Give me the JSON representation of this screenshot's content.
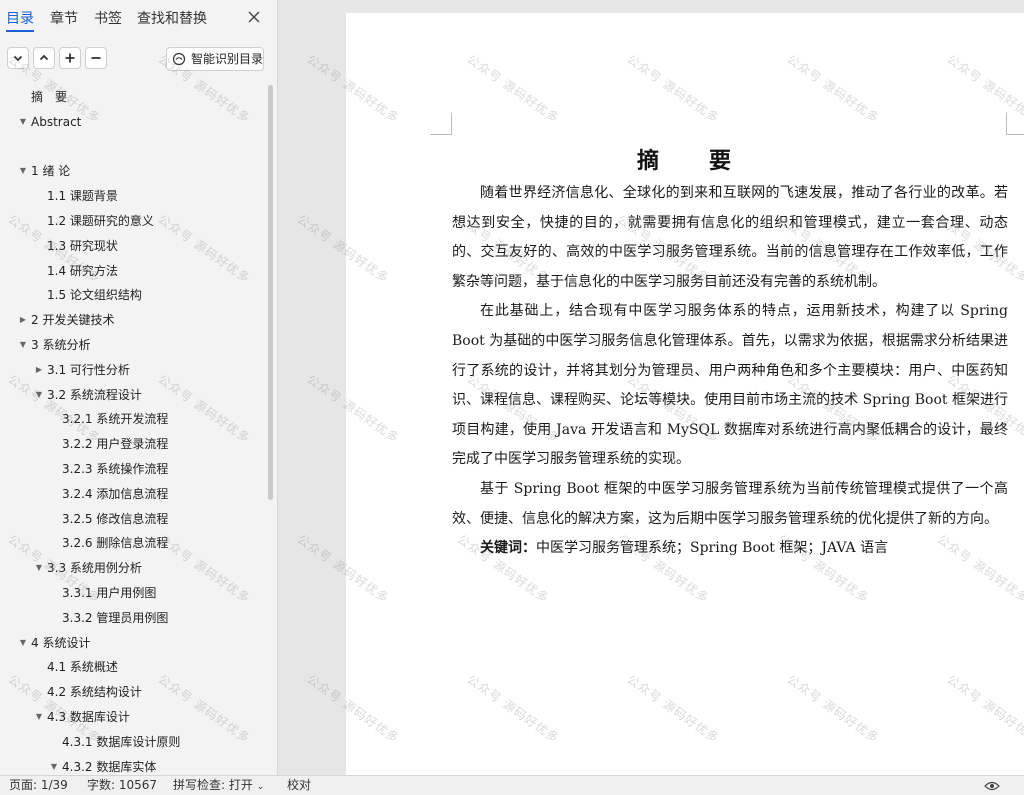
{
  "nav": {
    "tabs": [
      {
        "label": "目录",
        "active": true
      },
      {
        "label": "章节"
      },
      {
        "label": "书签"
      },
      {
        "label": "查找和替换"
      }
    ],
    "smart_toc_label": "智能识别目录",
    "toc": [
      {
        "label": "摘　要",
        "level": 0,
        "caret": ""
      },
      {
        "label": "Abstract",
        "level": 0,
        "caret": "expanded"
      },
      {
        "label": "",
        "level": 1,
        "caret": ""
      },
      {
        "label": "1 绪 论",
        "level": 0,
        "caret": "expanded"
      },
      {
        "label": "1.1 课题背景",
        "level": 1,
        "caret": ""
      },
      {
        "label": "1.2 课题研究的意义",
        "level": 1,
        "caret": ""
      },
      {
        "label": "1.3 研究现状",
        "level": 1,
        "caret": ""
      },
      {
        "label": "1.4 研究方法",
        "level": 1,
        "caret": ""
      },
      {
        "label": "1.5 论文组织结构",
        "level": 1,
        "caret": ""
      },
      {
        "label": "2 开发关键技术",
        "level": 0,
        "caret": "collapsed"
      },
      {
        "label": "3 系统分析",
        "level": 0,
        "caret": "expanded"
      },
      {
        "label": "3.1 可行性分析",
        "level": 1,
        "caret": "collapsed"
      },
      {
        "label": "3.2 系统流程设计",
        "level": 1,
        "caret": "expanded"
      },
      {
        "label": "3.2.1 系统开发流程",
        "level": 2,
        "caret": ""
      },
      {
        "label": "3.2.2 用户登录流程",
        "level": 2,
        "caret": ""
      },
      {
        "label": "3.2.3 系统操作流程",
        "level": 2,
        "caret": ""
      },
      {
        "label": "3.2.4 添加信息流程",
        "level": 2,
        "caret": ""
      },
      {
        "label": "3.2.5 修改信息流程",
        "level": 2,
        "caret": ""
      },
      {
        "label": "3.2.6 删除信息流程",
        "level": 2,
        "caret": ""
      },
      {
        "label": "3.3 系统用例分析",
        "level": 1,
        "caret": "expanded"
      },
      {
        "label": "3.3.1 用户用例图",
        "level": 2,
        "caret": ""
      },
      {
        "label": "3.3.2 管理员用例图",
        "level": 2,
        "caret": ""
      },
      {
        "label": "4 系统设计",
        "level": 0,
        "caret": "expanded"
      },
      {
        "label": "4.1 系统概述",
        "level": 1,
        "caret": ""
      },
      {
        "label": "4.2 系统结构设计",
        "level": 1,
        "caret": ""
      },
      {
        "label": "4.3 数据库设计",
        "level": 1,
        "caret": "expanded"
      },
      {
        "label": "4.3.1 数据库设计原则",
        "level": 2,
        "caret": ""
      },
      {
        "label": "4.3.2 数据库实体",
        "level": 2,
        "caret": "expanded"
      }
    ]
  },
  "document": {
    "title": "摘　要",
    "paragraphs": [
      "随着世界经济信息化、全球化的到来和互联网的飞速发展，推动了各行业的改革。若想达到安全，快捷的目的，就需要拥有信息化的组织和管理模式，建立一套合理、动态的、交互友好的、高效的中医学习服务管理系统。当前的信息管理存在工作效率低，工作繁杂等问题，基于信息化的中医学习服务目前还没有完善的系统机制。",
      "在此基础上，结合现有中医学习服务体系的特点，运用新技术，构建了以 Spring Boot 为基础的中医学习服务信息化管理体系。首先，以需求为依据，根据需求分析结果进行了系统的设计，并将其划分为管理员、用户两种角色和多个主要模块：用户、中医药知识、课程信息、课程购买、论坛等模块。使用目前市场主流的技术 Spring Boot 框架进行项目构建，使用 Java 开发语言和 MySQL 数据库对系统进行高内聚低耦合的设计，最终完成了中医学习服务管理系统的实现。",
      "基于 Spring Boot 框架的中医学习服务管理系统为当前传统管理模式提供了一个高效、便捷、信息化的解决方案，这为后期中医学习服务管理系统的优化提供了新的方向。"
    ],
    "keywords_label": "关键词：",
    "keywords": "中医学习服务管理系统；Spring Boot 框架；JAVA 语言",
    "watermark": "公众号 源码好优多"
  },
  "status": {
    "page": "页面: 1/39",
    "words": "字数: 10567",
    "spellcheck": "拼写检查: 打开",
    "proof": "校对"
  },
  "icons": [
    "close-icon",
    "chevron-down-icon",
    "chevron-up-icon",
    "plus-icon",
    "minus-icon",
    "smart-toc-icon",
    "eye-icon",
    "caret-down-icon",
    "caret-right-icon"
  ],
  "colors": {
    "accent": "#1a5fd3",
    "pane": "#f3f3f3",
    "workspace": "#e6e6e6",
    "page": "#ffffff"
  }
}
